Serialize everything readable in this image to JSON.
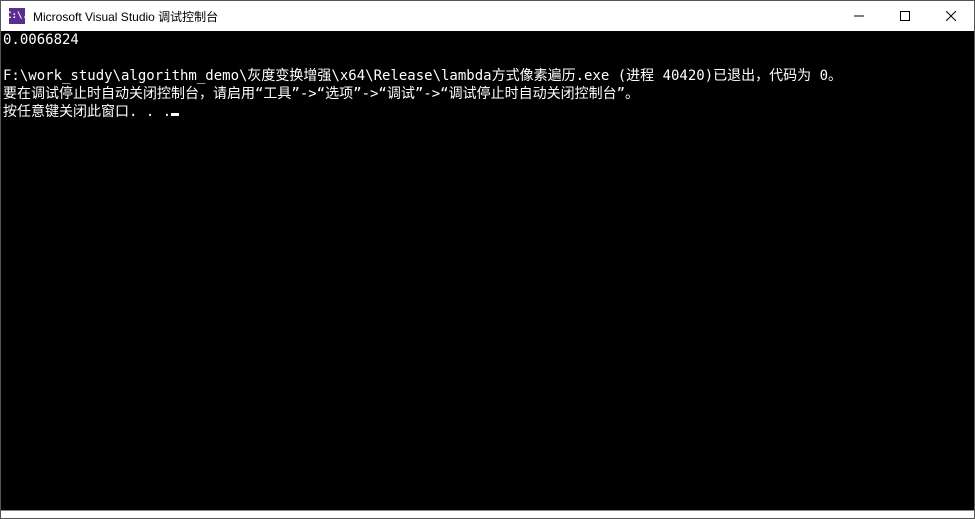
{
  "window": {
    "title": "Microsoft Visual Studio 调试控制台",
    "icon_label": "C:\\."
  },
  "console": {
    "line1": "0.0066824",
    "line2": "",
    "line3": "F:\\work_study\\algorithm_demo\\灰度变换增强\\x64\\Release\\lambda方式像素遍历.exe (进程 40420)已退出，代码为 0。",
    "line4": "要在调试停止时自动关闭控制台，请启用“工具”->“选项”->“调试”->“调试停止时自动关闭控制台”。",
    "line5": "按任意键关闭此窗口. . ."
  }
}
